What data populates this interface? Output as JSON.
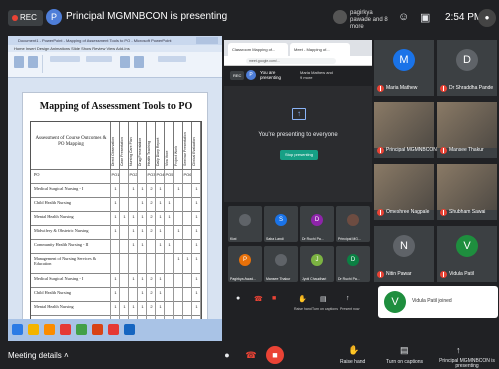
{
  "topbar": {
    "rec_label": "REC",
    "presenter_initial": "P",
    "presenting_text": "Principal MGMNBCON is presenting",
    "speakers": "pagirkya pawade and 8 more",
    "time": "2:54 PM"
  },
  "shared_screen": {
    "window_title": "Document1 - PowerPoint - Mapping of Assessment Tools to PO - Microsoft PowerPoint",
    "ribbon_tabs": "Home   Insert   Design   Animations   Slide Show   Review   View   Add-Ins",
    "slide_title": "Mapping of Assessment Tools to PO",
    "header_first": "Assessment of Course Outcomes & PO Mapping",
    "col_headers": [
      "Direct Observation",
      "Case Presentation",
      "Nursing Care Plan",
      "Drug Presentation",
      "Health Teaching",
      "Daily Diary Report",
      "Viva Voce",
      "Project Work",
      "Seminar Presentation",
      "Clinical Evaluation"
    ],
    "po_row": {
      "label": "PO",
      "values": [
        "PO1",
        "",
        "PO2",
        "",
        "PO3",
        "PO4",
        "PO5",
        "",
        "PO6",
        ""
      ]
    },
    "rows": [
      {
        "label": "Medical Surgical Nursing - I",
        "values": [
          "1",
          "",
          "1",
          "1",
          "2",
          "1",
          "",
          "1",
          "",
          "1"
        ]
      },
      {
        "label": "Child Health Nursing",
        "values": [
          "1",
          "",
          "",
          "1",
          "2",
          "1",
          "1",
          "",
          "",
          "1"
        ]
      },
      {
        "label": "Mental Health Nursing",
        "values": [
          "1",
          "1",
          "1",
          "1",
          "2",
          "1",
          "1",
          "",
          "",
          "1"
        ]
      },
      {
        "label": "Midwifery & Obstetric Nursing",
        "values": [
          "1",
          "",
          "1",
          "1",
          "2",
          "1",
          "",
          "1",
          "",
          "1"
        ]
      },
      {
        "label": "Community Health Nursing - II",
        "values": [
          "",
          "",
          "1",
          "1",
          "",
          "1",
          "1",
          "",
          "",
          "1"
        ]
      },
      {
        "label": "Management of Nursing Services & Education",
        "values": [
          "",
          "",
          "",
          "",
          "",
          "",
          "",
          "1",
          "1",
          "1"
        ]
      },
      {
        "label": "Medical Surgical Nursing - I",
        "values": [
          "1",
          "",
          "1",
          "1",
          "2",
          "1",
          "",
          "",
          "",
          "1"
        ]
      },
      {
        "label": "Child Health Nursing",
        "values": [
          "1",
          "",
          "",
          "1",
          "2",
          "1",
          "",
          "",
          "",
          "1"
        ]
      },
      {
        "label": "Mental Health Nursing",
        "values": [
          "1",
          "1",
          "1",
          "1",
          "2",
          "1",
          "",
          "",
          "",
          "1"
        ]
      },
      {
        "label": "Midwifery & Obstetric Nursing",
        "values": [
          "1",
          "",
          "1",
          "1",
          "2",
          "1",
          "",
          "",
          "",
          "1"
        ]
      }
    ]
  },
  "presenter_view": {
    "tab1": "Classroom Mapping of...",
    "tab2": "Meet - Mapping of...",
    "url": "meet.google.com/...",
    "rec_label": "REC",
    "initial": "P",
    "you_are_presenting": "You are presenting",
    "others": "Maria Mathew and 9 more",
    "presenting_msg": "You're presenting to everyone",
    "stop_button": "Stop presenting",
    "tiles": [
      {
        "name": "Kiwi",
        "initial": "",
        "color": "#5f6368"
      },
      {
        "name": "Saba Landi",
        "initial": "S",
        "color": "#1a73e8"
      },
      {
        "name": "Dr Ruchi Pa...",
        "initial": "D",
        "color": "#8e24aa"
      },
      {
        "name": "Principal MG...",
        "initial": "",
        "color": "#6d4c41"
      },
      {
        "name": "Pagirkya Awad...",
        "initial": "P",
        "color": "#e8710a"
      },
      {
        "name": "Mansee Thakur",
        "initial": "",
        "color": "#5f6368"
      },
      {
        "name": "Jyoti Chaudhari",
        "initial": "J",
        "color": "#7cb342"
      },
      {
        "name": "Dr Ruchi Pa...",
        "initial": "D",
        "color": "#0b8043"
      }
    ],
    "controls": [
      "Raise hand",
      "Turn on captions",
      "Present now"
    ]
  },
  "participants": [
    {
      "name": "Maria Mathew",
      "initial": "M",
      "color": "#1a73e8",
      "photo": false
    },
    {
      "name": "Dr Shraddha Pande",
      "initial": "D",
      "color": "#5f6368",
      "photo": false
    },
    {
      "name": "Principal MGMNBCON",
      "initial": "",
      "color": "#6d4c41",
      "photo": true
    },
    {
      "name": "Mansee Thakur",
      "initial": "",
      "color": "#5f6368",
      "photo": true
    },
    {
      "name": "Omeshree Nagpale",
      "initial": "",
      "color": "#5f6368",
      "photo": true
    },
    {
      "name": "Shubham Sawai",
      "initial": "",
      "color": "#5f6368",
      "photo": true
    },
    {
      "name": "Nitin Pawar",
      "initial": "N",
      "color": "#5f6368",
      "photo": false
    },
    {
      "name": "Vidula Patil",
      "initial": "V",
      "color": "#1e8e3e",
      "photo": false
    }
  ],
  "toast": {
    "initial": "V",
    "message": "Vidula Patil joined"
  },
  "bottombar": {
    "meeting_details": "Meeting details",
    "raise_hand": "Raise hand",
    "captions": "Turn on captions",
    "present": "Principal MGMNBCON is presenting"
  },
  "colors": {
    "bg": "#202124",
    "danger": "#ea4335",
    "accent": "#1a73e8"
  }
}
